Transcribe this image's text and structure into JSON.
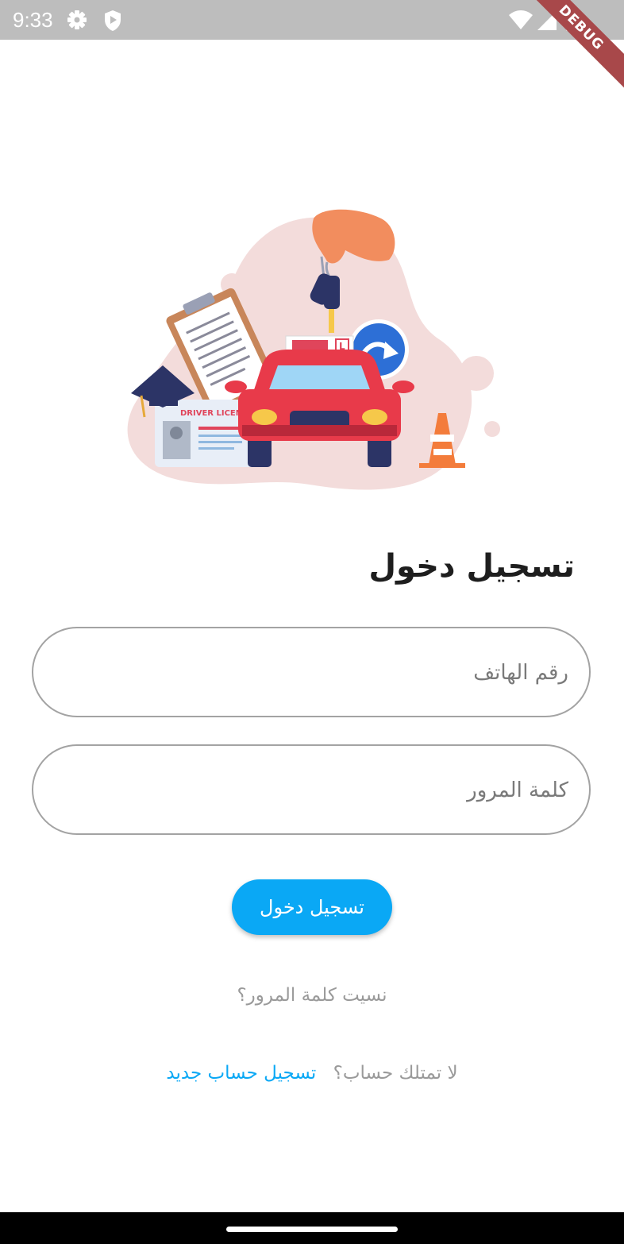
{
  "status_bar": {
    "time": "9:33",
    "debug_label": "DEBUG"
  },
  "illustration": {
    "license_text": "DRIVER LICENSE",
    "plate_letter": "L"
  },
  "login": {
    "title": "تسجيل دخول",
    "phone_placeholder": "رقم الهاتف",
    "password_placeholder": "كلمة المرور",
    "button_label": "تسجيل دخول",
    "forgot_password": "نسيت كلمة المرور؟",
    "no_account_prompt": "لا تمتلك حساب؟",
    "register_link": "تسجيل حساب جديد"
  },
  "colors": {
    "accent": "#0aa8f5",
    "status_bar": "#bdbdbd",
    "debug_banner": "#a8484a"
  }
}
